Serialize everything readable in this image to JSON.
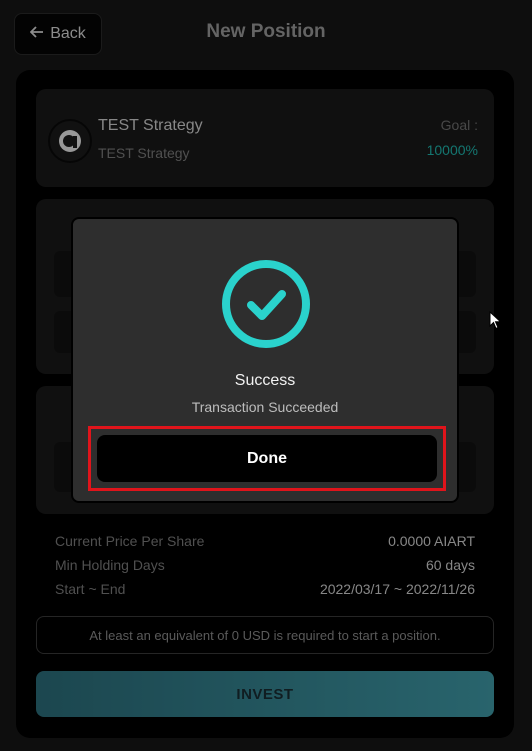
{
  "header": {
    "back_label": "Back",
    "title": "New Position"
  },
  "strategy": {
    "name": "TEST Strategy",
    "subtitle": "TEST Strategy",
    "goal_label": "Goal :",
    "goal_value": "10000%"
  },
  "info": [
    {
      "label": "Current Price Per Share",
      "value": "0.0000 AIART"
    },
    {
      "label": "Min Holding Days",
      "value": "60 days"
    },
    {
      "label": "Start ~ End",
      "value": "2022/03/17 ~ 2022/11/26"
    }
  ],
  "notice": "At least an equivalent of 0 USD is required to start a position.",
  "invest_label": "INVEST",
  "modal": {
    "title": "Success",
    "subtitle": "Transaction Succeeded",
    "done_label": "Done"
  },
  "colors": {
    "accent": "#1fb5ad",
    "success_ring": "#2ad2cc",
    "highlight": "#e0141b"
  },
  "icons": {
    "back": "arrow-left-icon",
    "logo": "strategy-logo-icon",
    "success": "check-circle-icon",
    "cursor": "mouse-cursor-icon"
  }
}
